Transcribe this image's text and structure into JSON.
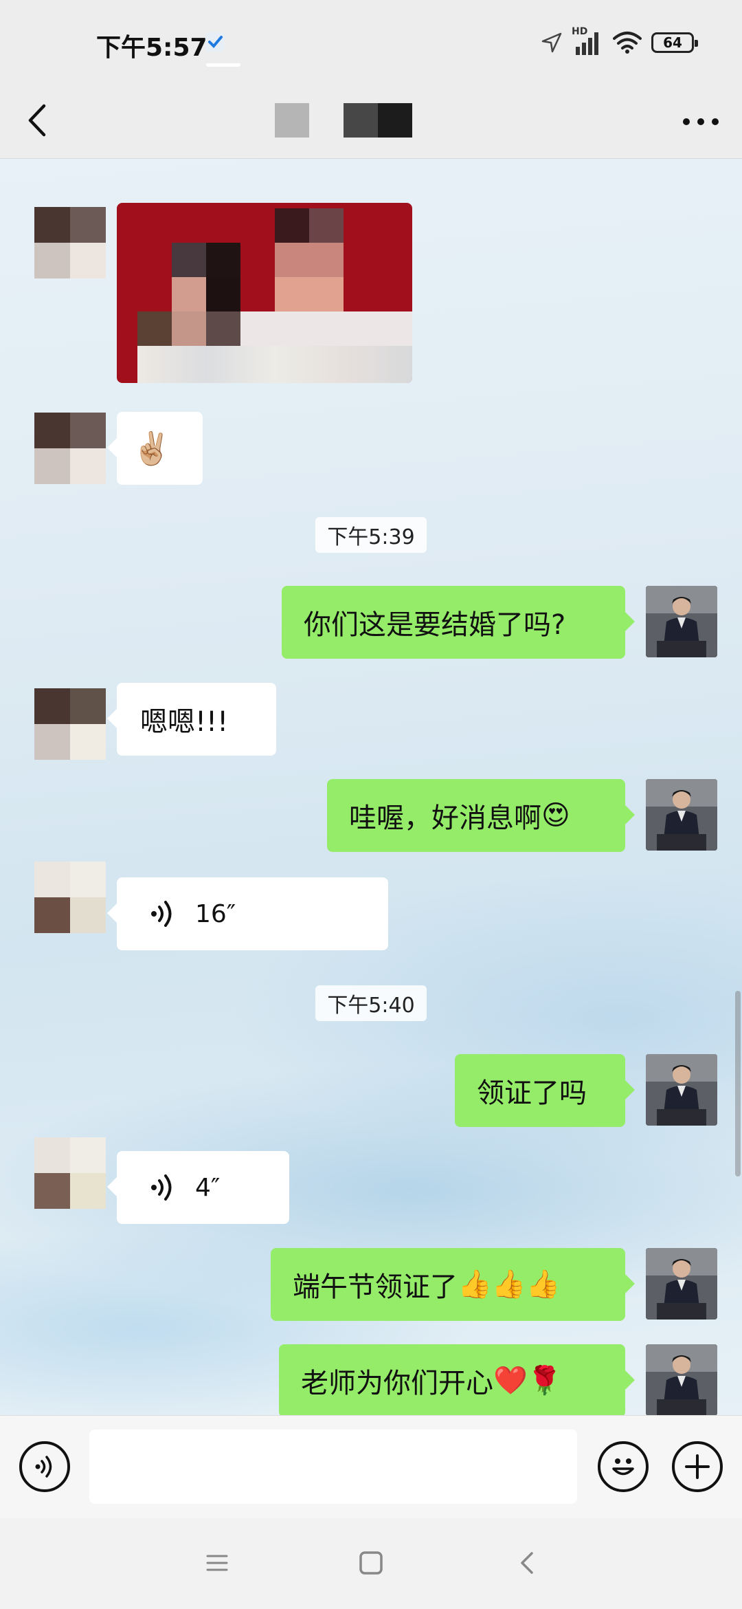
{
  "status_bar": {
    "time": "下午5:57",
    "network": "HD",
    "battery": "64"
  },
  "header": {
    "title": ""
  },
  "messages": [
    {
      "type": "image",
      "side": "left"
    },
    {
      "type": "emoji",
      "side": "left",
      "text": "✌🏼"
    },
    {
      "type": "timestamp",
      "text": "下午5:39"
    },
    {
      "type": "text",
      "side": "right",
      "text": "你们这是要结婚了吗?"
    },
    {
      "type": "text",
      "side": "left",
      "text": "嗯嗯!!!"
    },
    {
      "type": "text",
      "side": "right",
      "text": "哇喔，好消息啊",
      "emoji": "😍"
    },
    {
      "type": "voice",
      "side": "left",
      "duration": "16″"
    },
    {
      "type": "timestamp",
      "text": "下午5:40"
    },
    {
      "type": "text",
      "side": "right",
      "text": "领证了吗"
    },
    {
      "type": "voice",
      "side": "left",
      "duration": "4″"
    },
    {
      "type": "text",
      "side": "right",
      "text": "端午节领证了",
      "emoji": "👍👍👍"
    },
    {
      "type": "text",
      "side": "right",
      "text": "老师为你们开心",
      "emoji": "❤️🌹"
    }
  ],
  "input_bar": {
    "value": "",
    "icons": [
      "voice-icon",
      "emoji-icon",
      "plus-icon"
    ]
  },
  "nav_bar": {
    "icons": [
      "menu-icon",
      "home-icon",
      "back-icon"
    ]
  },
  "colors": {
    "my_bubble": "#95ec69",
    "their_bubble": "#ffffff",
    "background": "#ededed"
  }
}
